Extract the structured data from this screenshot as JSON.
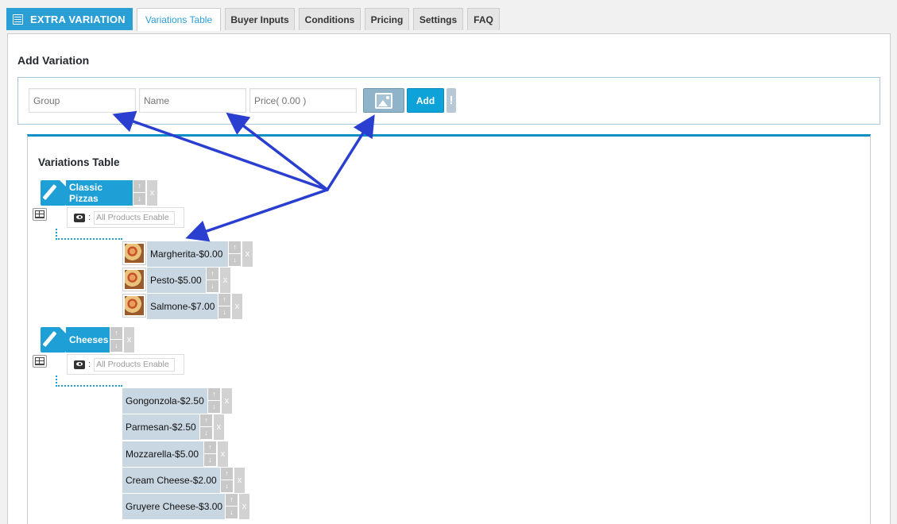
{
  "brand": {
    "label": "EXTRA VARIATION",
    "icon": "table-list-icon"
  },
  "tabs": [
    {
      "label": "Variations Table",
      "active": true
    },
    {
      "label": "Buyer Inputs"
    },
    {
      "label": "Conditions"
    },
    {
      "label": "Pricing"
    },
    {
      "label": "Settings"
    },
    {
      "label": "FAQ"
    }
  ],
  "add_variation": {
    "title": "Add Variation",
    "group_placeholder": "Group",
    "name_placeholder": "Name",
    "price_placeholder": "Price( 0.00 )",
    "add_label": "Add",
    "warn_label": "!"
  },
  "variations_table": {
    "title": "Variations Table",
    "up_symbol": "↑",
    "down_symbol": "↓",
    "remove_symbol": "x",
    "visibility_separator": ":",
    "groups": [
      {
        "name": "Classic Pizzas",
        "visibility": "All Products Enable",
        "items": [
          {
            "label": "Margherita-$0.00"
          },
          {
            "label": "Pesto-$5.00"
          },
          {
            "label": "Salmone-$7.00"
          }
        ]
      },
      {
        "name": "Cheeses",
        "visibility": "All Products Enable",
        "items": [
          {
            "label": "Gongonzola-$2.50"
          },
          {
            "label": "Parmesan-$2.50"
          },
          {
            "label": "Mozzarella-$5.00"
          },
          {
            "label": "Cream Cheese-$2.00"
          },
          {
            "label": "Gruyere Cheese-$3.00"
          }
        ]
      }
    ]
  },
  "colors": {
    "accent": "#1e9fd6",
    "item_bg": "#c9d7e3",
    "annotation": "#2a3fd0"
  }
}
